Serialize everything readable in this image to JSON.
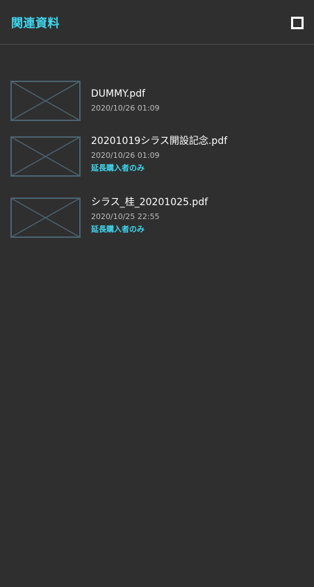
{
  "header": {
    "title": "関連資料",
    "close_icon": "square-close-icon"
  },
  "colors": {
    "background": "#2f2f2f",
    "accent": "#3fd6ee",
    "thumbnail_stroke": "#4c6470",
    "divider": "#4a4a4a"
  },
  "files": [
    {
      "name": "DUMMY.pdf",
      "date": "2020/10/26 01:09",
      "badge": null,
      "thumbnail_icon": "placeholder-image-icon"
    },
    {
      "name": "20201019シラス開設記念.pdf",
      "date": "2020/10/26 01:09",
      "badge": "延長購入者のみ",
      "thumbnail_icon": "placeholder-image-icon"
    },
    {
      "name": "シラス_桂_20201025.pdf",
      "date": "2020/10/25 22:55",
      "badge": "延長購入者のみ",
      "thumbnail_icon": "placeholder-image-icon"
    }
  ]
}
